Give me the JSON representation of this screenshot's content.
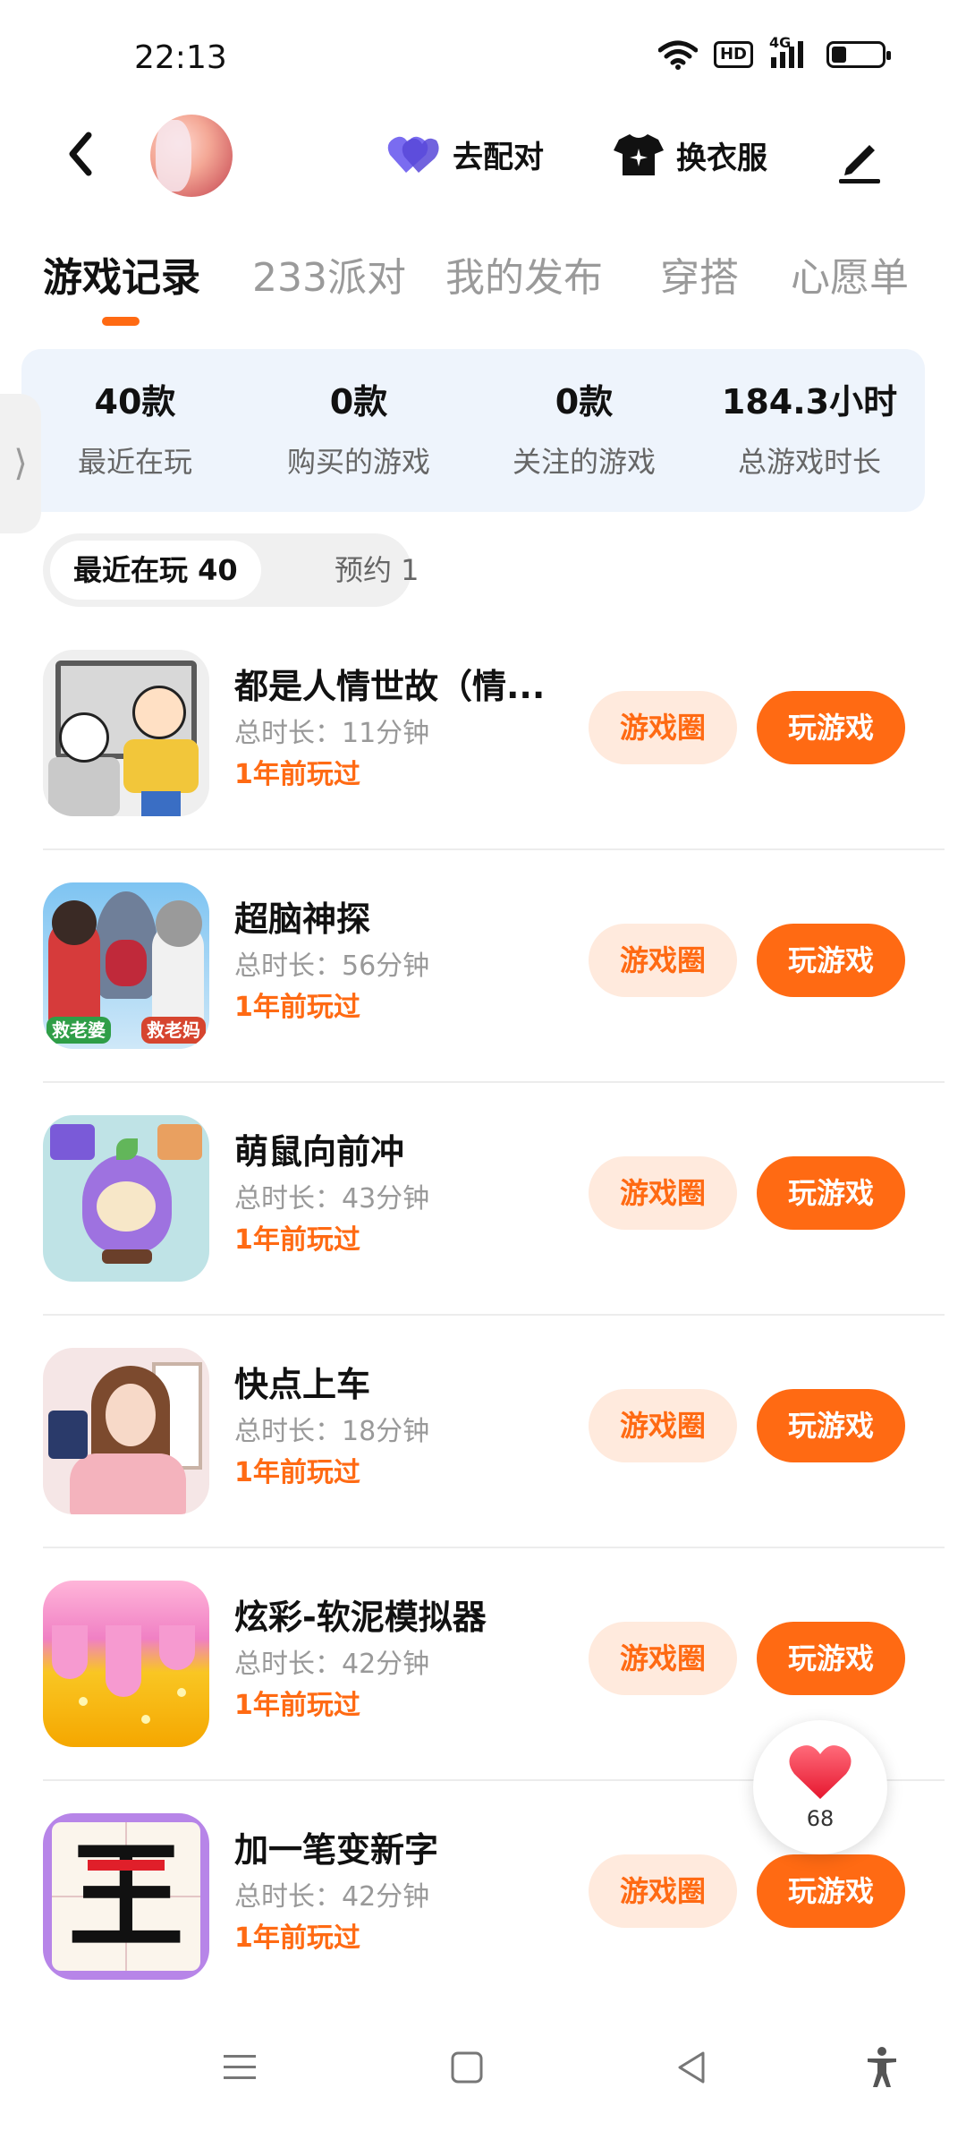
{
  "status_bar": {
    "time": "22:13",
    "network": "4G",
    "hd": "HD",
    "battery_level": 0.3
  },
  "header": {
    "pair_label": "去配对",
    "outfit_label": "换衣服",
    "colors": {
      "pair_heart": "#6b5ce7",
      "outfit_icon": "#111111"
    }
  },
  "tabs": [
    "游戏记录",
    "233派对",
    "我的发布",
    "穿搭",
    "心愿单"
  ],
  "stats": [
    {
      "value": "40款",
      "label": "最近在玩"
    },
    {
      "value": "0款",
      "label": "购买的游戏"
    },
    {
      "value": "0款",
      "label": "关注的游戏"
    },
    {
      "value": "184.3小时",
      "label": "总游戏时长"
    }
  ],
  "sub_tabs": {
    "recent": "最近在玩 40",
    "reserved": "预约 1"
  },
  "games": [
    {
      "title": "都是人情世故（情...",
      "duration": "总时长：11分钟",
      "last_played": "1年前玩过",
      "circle": "游戏圈",
      "play": "玩游戏"
    },
    {
      "title": "超脑神探",
      "duration": "总时长：56分钟",
      "last_played": "1年前玩过",
      "circle": "游戏圈",
      "play": "玩游戏",
      "badges": [
        "救老婆",
        "救老妈"
      ]
    },
    {
      "title": "萌鼠向前冲",
      "duration": "总时长：43分钟",
      "last_played": "1年前玩过",
      "circle": "游戏圈",
      "play": "玩游戏"
    },
    {
      "title": "快点上车",
      "duration": "总时长：18分钟",
      "last_played": "1年前玩过",
      "circle": "游戏圈",
      "play": "玩游戏"
    },
    {
      "title": "炫彩-软泥模拟器",
      "duration": "总时长：42分钟",
      "last_played": "1年前玩过",
      "circle": "游戏圈",
      "play": "玩游戏"
    },
    {
      "title": "加一笔变新字",
      "duration": "总时长：42分钟",
      "last_played": "1年前玩过",
      "circle": "游戏圈",
      "play": "玩游戏",
      "glyph": "王"
    }
  ],
  "float_like": {
    "count": "68"
  },
  "colors": {
    "accent": "#ff6a13",
    "accent_light": "#ffeadd",
    "stats_bg": "#eef4fc"
  }
}
